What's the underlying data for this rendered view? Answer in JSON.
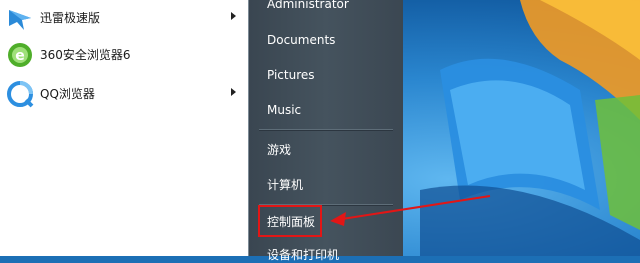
{
  "programs": [
    {
      "label": "迅雷极速版",
      "icon": "xunlei-icon",
      "has_submenu": true
    },
    {
      "label": "360安全浏览器6",
      "icon": "360-browser-icon",
      "has_submenu": false
    },
    {
      "label": "QQ浏览器",
      "icon": "qq-browser-icon",
      "has_submenu": true
    }
  ],
  "right_menu": {
    "user": "Administrator",
    "documents": "Documents",
    "pictures": "Pictures",
    "music": "Music",
    "games": "游戏",
    "computer": "计算机",
    "control_panel": "控制面板",
    "devices_printers": "设备和打印机"
  },
  "colors": {
    "annotation_red": "#e21616",
    "menu_dark": "#45535e"
  }
}
